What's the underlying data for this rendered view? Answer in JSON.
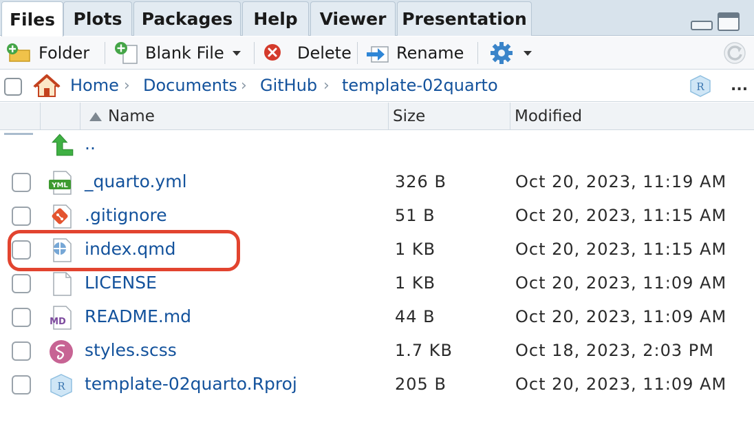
{
  "tabs": [
    {
      "label": "Files",
      "active": true
    },
    {
      "label": "Plots"
    },
    {
      "label": "Packages"
    },
    {
      "label": "Help"
    },
    {
      "label": "Viewer"
    },
    {
      "label": "Presentation"
    }
  ],
  "toolbar": {
    "folder_label": "Folder",
    "blank_file_label": "Blank File",
    "delete_label": "Delete",
    "rename_label": "Rename"
  },
  "breadcrumb": {
    "items": [
      "Home",
      "Documents",
      "GitHub",
      "template-02quarto"
    ],
    "separator": "›",
    "more": "..."
  },
  "columns": {
    "name": "Name",
    "size": "Size",
    "modified": "Modified"
  },
  "files": [
    {
      "name": "..",
      "size": "",
      "modified": "",
      "icon": "up-arrow-icon"
    },
    {
      "name": "_quarto.yml",
      "size": "326 B",
      "modified": "Oct 20, 2023, 11:19 AM",
      "icon": "yml-file-icon"
    },
    {
      "name": ".gitignore",
      "size": "51 B",
      "modified": "Oct 20, 2023, 11:15 AM",
      "icon": "git-file-icon"
    },
    {
      "name": "index.qmd",
      "size": "1 KB",
      "modified": "Oct 20, 2023, 11:15 AM",
      "icon": "quarto-file-icon"
    },
    {
      "name": "LICENSE",
      "size": "1 KB",
      "modified": "Oct 20, 2023, 11:09 AM",
      "icon": "blank-file-icon"
    },
    {
      "name": "README.md",
      "size": "44 B",
      "modified": "Oct 20, 2023, 11:09 AM",
      "icon": "markdown-file-icon"
    },
    {
      "name": "styles.scss",
      "size": "1.7 KB",
      "modified": "Oct 18, 2023, 2:03 PM",
      "icon": "sass-file-icon"
    },
    {
      "name": "template-02quarto.Rproj",
      "size": "205 B",
      "modified": "Oct 20, 2023, 11:09 AM",
      "icon": "rproj-file-icon"
    }
  ],
  "colors": {
    "link": "#13529c",
    "highlight": "#e2442f",
    "tabbar": "#d8e3ec"
  }
}
